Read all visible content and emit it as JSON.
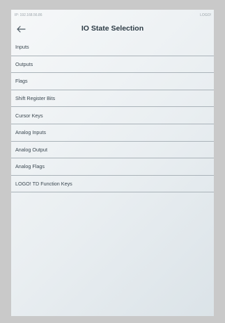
{
  "status": {
    "ip": "IP: 192.168.56.86",
    "brand": "LOGO!"
  },
  "header": {
    "title": "IO State Selection",
    "back_icon": "arrow-left-icon"
  },
  "items": [
    {
      "label": "Inputs"
    },
    {
      "label": "Outputs"
    },
    {
      "label": "Flags"
    },
    {
      "label": "Shift Register Bits"
    },
    {
      "label": "Cursor Keys"
    },
    {
      "label": "Analog Inputs"
    },
    {
      "label": "Analog Output"
    },
    {
      "label": "Analog Flags"
    },
    {
      "label": "LOGO! TD Function Keys"
    }
  ],
  "colors": {
    "background": "#c9c9c9",
    "panel": "#eef2f4",
    "divider": "#a9b2b8",
    "title": "#2b3a44"
  }
}
